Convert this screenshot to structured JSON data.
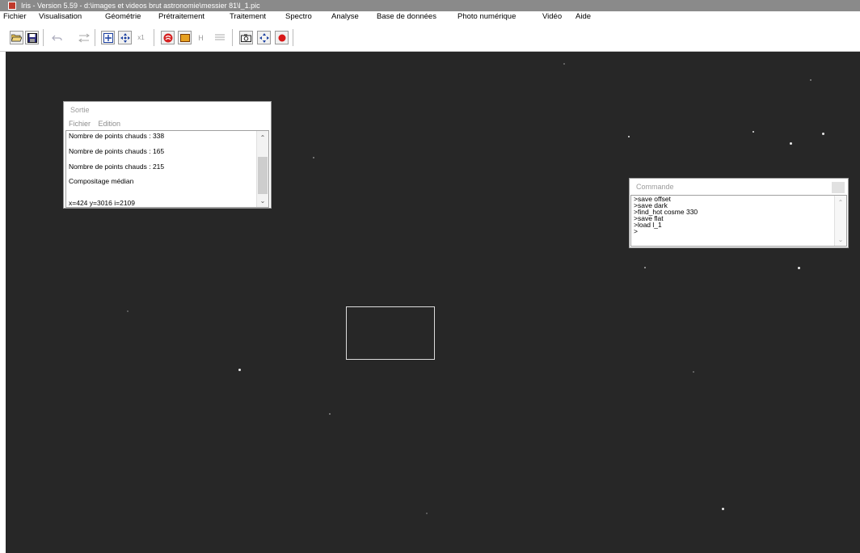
{
  "app": {
    "title": "Iris - Version 5.59 - d:\\images et videos brut astronomie\\messier 81\\l_1.pic"
  },
  "menu": [
    "Fichier",
    "Visualisation",
    "Géométrie",
    "Prétraitement",
    "Traitement",
    "Spectro",
    "Analyse",
    "Base de données",
    "Photo numérique",
    "Vidéo",
    "Aide"
  ],
  "toolbar": {
    "x1_label": "x1",
    "h_label": "H"
  },
  "sortie": {
    "title": "Sortie",
    "menu": [
      "Fichier",
      "Edition"
    ],
    "lines": [
      "Nombre de points chauds : 338",
      "Nombre de points chauds : 165",
      "Nombre de points chauds : 215",
      "Compositage médian",
      "",
      "x=424  y=3016  i=2109"
    ]
  },
  "commande": {
    "title": "Commande",
    "lines": [
      ">save offset",
      ">save dark",
      ">find_hot cosme 330",
      ">save flat",
      ">load l_1",
      ">"
    ]
  },
  "colors": {
    "titlebar": "#8a8a8a",
    "canvas": "#272727",
    "app_icon": "#c0392b"
  }
}
